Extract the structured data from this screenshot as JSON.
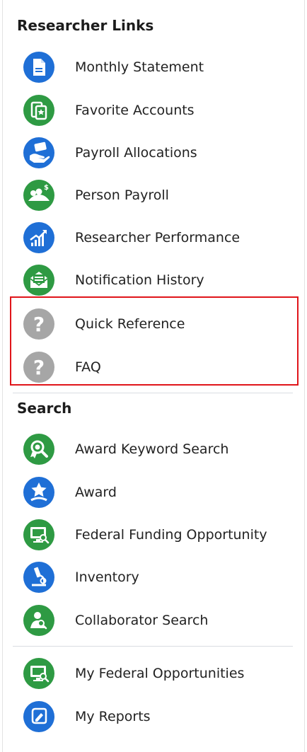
{
  "researcher_links": {
    "title": "Researcher Links",
    "items": [
      {
        "label": "Monthly Statement",
        "icon": "document-icon",
        "color": "#1f6fd6"
      },
      {
        "label": "Favorite Accounts",
        "icon": "clipboard-star-icon",
        "color": "#2e9a43"
      },
      {
        "label": "Payroll Allocations",
        "icon": "payroll-card-icon",
        "color": "#1f6fd6"
      },
      {
        "label": "Person Payroll",
        "icon": "people-money-icon",
        "color": "#2e9a43"
      },
      {
        "label": "Researcher Performance",
        "icon": "chart-growth-icon",
        "color": "#1f6fd6"
      },
      {
        "label": "Notification History",
        "icon": "envelope-icon",
        "color": "#2e9a43"
      },
      {
        "label": "Quick Reference",
        "icon": "question-icon",
        "color": "#a6a6a6"
      },
      {
        "label": "FAQ",
        "icon": "question-icon",
        "color": "#a6a6a6"
      }
    ]
  },
  "search": {
    "title": "Search",
    "items": [
      {
        "label": "Award Keyword Search",
        "icon": "award-search-icon",
        "color": "#2e9a43"
      },
      {
        "label": "Award",
        "icon": "award-star-icon",
        "color": "#1f6fd6"
      },
      {
        "label": "Federal Funding Opportunity",
        "icon": "monitor-search-icon",
        "color": "#2e9a43"
      },
      {
        "label": "Inventory",
        "icon": "microscope-icon",
        "color": "#1f6fd6"
      },
      {
        "label": "Collaborator Search",
        "icon": "person-search-icon",
        "color": "#2e9a43"
      }
    ]
  },
  "my_links": {
    "items": [
      {
        "label": "My Federal Opportunities",
        "icon": "monitor-search-icon",
        "color": "#2e9a43"
      },
      {
        "label": "My Reports",
        "icon": "report-icon",
        "color": "#1f6fd6"
      }
    ]
  },
  "colors": {
    "blue": "#1f6fd6",
    "green": "#2e9a43",
    "gray": "#a6a6a6",
    "highlight": "#e0151a"
  }
}
